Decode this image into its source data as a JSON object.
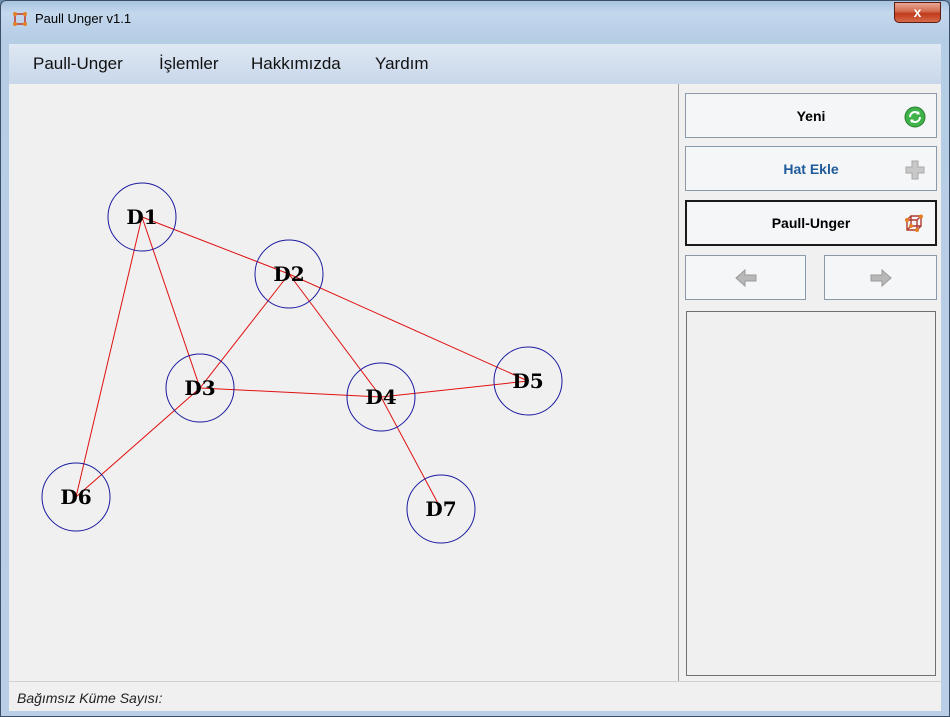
{
  "window": {
    "title": "Paull Unger v1.1",
    "close_label": "x"
  },
  "menu": {
    "items": [
      "Paull-Unger",
      "İşlemler",
      "Hakkımızda",
      "Yardım"
    ]
  },
  "toolbar": {
    "new_label": "Yeni",
    "add_edge_label": "Hat Ekle",
    "paull_unger_label": "Paull-Unger",
    "new_icon": "refresh-icon",
    "add_edge_icon": "plus-icon",
    "paull_unger_icon": "graph-cube-icon",
    "prev_icon": "arrow-left-icon",
    "next_icon": "arrow-right-icon"
  },
  "graph": {
    "node_color": "#1a1aa0",
    "edge_color": "#e01010",
    "nodes": [
      {
        "id": "D1",
        "label": "D1"
      },
      {
        "id": "D2",
        "label": "D2"
      },
      {
        "id": "D3",
        "label": "D3"
      },
      {
        "id": "D4",
        "label": "D4"
      },
      {
        "id": "D5",
        "label": "D5"
      },
      {
        "id": "D6",
        "label": "D6"
      },
      {
        "id": "D7",
        "label": "D7"
      }
    ],
    "edges": [
      [
        "D1",
        "D2"
      ],
      [
        "D1",
        "D3"
      ],
      [
        "D1",
        "D6"
      ],
      [
        "D2",
        "D3"
      ],
      [
        "D2",
        "D4"
      ],
      [
        "D2",
        "D5"
      ],
      [
        "D3",
        "D4"
      ],
      [
        "D3",
        "D6"
      ],
      [
        "D4",
        "D5"
      ],
      [
        "D4",
        "D7"
      ]
    ]
  },
  "status": {
    "label": "Bağımsız Küme Sayısı:"
  }
}
